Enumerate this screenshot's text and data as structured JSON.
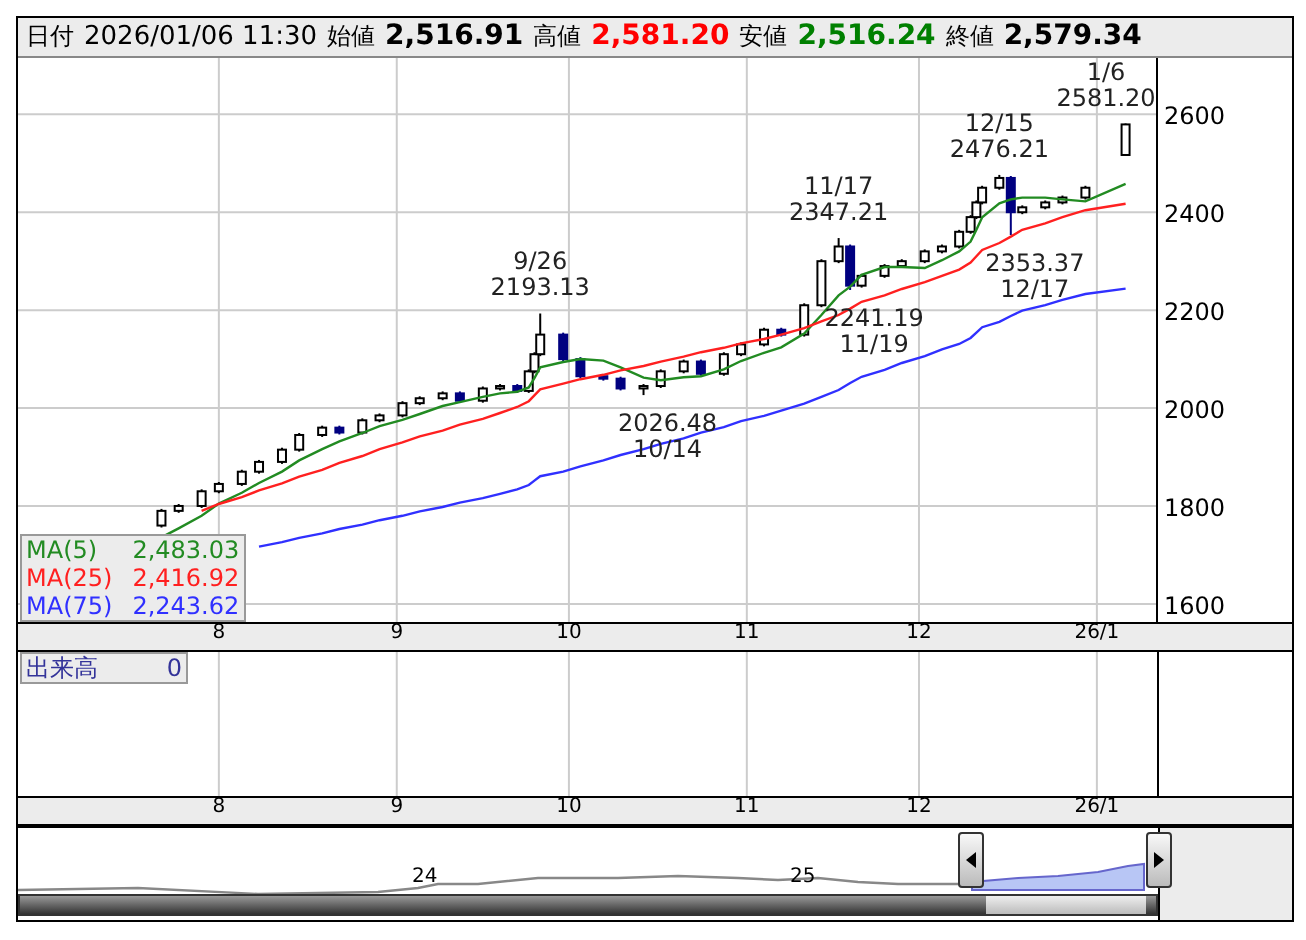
{
  "header": {
    "date_label": "日付",
    "date": "2026/01/06 11:30",
    "quotes": [
      {
        "label": "始値",
        "value": "2,516.91",
        "color": "#000000"
      },
      {
        "label": "高値",
        "value": "2,581.20",
        "color": "#ff0000"
      },
      {
        "label": "安値",
        "value": "2,516.24",
        "color": "#008000"
      },
      {
        "label": "終値",
        "value": "2,579.34",
        "color": "#000000"
      }
    ]
  },
  "price_chart": {
    "chart_data": {
      "type": "candlestick",
      "grid": true,
      "legend": true,
      "x": [
        "2025-07-22",
        "2025-07-25",
        "2025-07-29",
        "2025-08-01",
        "2025-08-05",
        "2025-08-08",
        "2025-08-12",
        "2025-08-15",
        "2025-08-19",
        "2025-08-22",
        "2025-08-26",
        "2025-08-29",
        "2025-09-02",
        "2025-09-05",
        "2025-09-09",
        "2025-09-12",
        "2025-09-16",
        "2025-09-19",
        "2025-09-22",
        "2025-09-24",
        "2025-09-25",
        "2025-09-26",
        "2025-09-30",
        "2025-10-03",
        "2025-10-07",
        "2025-10-10",
        "2025-10-14",
        "2025-10-17",
        "2025-10-21",
        "2025-10-24",
        "2025-10-28",
        "2025-10-31",
        "2025-11-04",
        "2025-11-07",
        "2025-11-11",
        "2025-11-14",
        "2025-11-17",
        "2025-11-19",
        "2025-11-21",
        "2025-11-25",
        "2025-11-28",
        "2025-12-02",
        "2025-12-05",
        "2025-12-08",
        "2025-12-10",
        "2025-12-11",
        "2025-12-12",
        "2025-12-15",
        "2025-12-17",
        "2025-12-19",
        "2025-12-23",
        "2025-12-26",
        "2025-12-30",
        "2026-01-06"
      ],
      "xlim": [
        "2025-06-27",
        "2026-02-04"
      ],
      "ylim": [
        1563,
        2715
      ],
      "yticks": [
        {
          "value": 1600,
          "label": "1600"
        },
        {
          "value": 1800,
          "label": "1800"
        },
        {
          "value": 2000,
          "label": "2000"
        },
        {
          "value": 2200,
          "label": "2200"
        },
        {
          "value": 2400,
          "label": "2400"
        },
        {
          "value": 2600,
          "label": "2600"
        }
      ],
      "xticks": [
        {
          "value": "2025-08-01",
          "label": "8"
        },
        {
          "value": "2025-09-01",
          "label": "9"
        },
        {
          "value": "2025-10-01",
          "label": "10"
        },
        {
          "value": "2025-11-01",
          "label": "11"
        },
        {
          "value": "2025-12-01",
          "label": "12"
        },
        {
          "value": "2026-01-01",
          "label": "26/1"
        }
      ],
      "ohlc": [
        [
          1760,
          1794,
          1756,
          1790
        ],
        [
          1790,
          1804,
          1786,
          1800
        ],
        [
          1800,
          1834,
          1796,
          1830
        ],
        [
          1830,
          1849,
          1826,
          1845
        ],
        [
          1845,
          1874,
          1841,
          1870
        ],
        [
          1870,
          1894,
          1866,
          1890
        ],
        [
          1890,
          1919,
          1886,
          1915
        ],
        [
          1915,
          1949,
          1911,
          1945
        ],
        [
          1945,
          1964,
          1941,
          1960
        ],
        [
          1960,
          1964,
          1946,
          1950
        ],
        [
          1950,
          1979,
          1946,
          1975
        ],
        [
          1975,
          1989,
          1971,
          1985
        ],
        [
          1985,
          2014,
          1981,
          2010
        ],
        [
          2010,
          2024,
          2006,
          2020
        ],
        [
          2020,
          2034,
          2016,
          2030
        ],
        [
          2030,
          2034,
          2011,
          2015
        ],
        [
          2015,
          2044,
          2011,
          2040
        ],
        [
          2040,
          2049,
          2036,
          2045
        ],
        [
          2045,
          2049,
          2031,
          2035
        ],
        [
          2035,
          2079,
          2031,
          2075
        ],
        [
          2075,
          2114,
          2071,
          2110
        ],
        [
          2110,
          2193.13,
          2106,
          2150
        ],
        [
          2150,
          2154,
          2096,
          2100
        ],
        [
          2100,
          2104,
          2061,
          2065
        ],
        [
          2065,
          2069,
          2056,
          2060
        ],
        [
          2060,
          2064,
          2036,
          2040
        ],
        [
          2040,
          2049,
          2026.48,
          2045
        ],
        [
          2045,
          2079,
          2041,
          2075
        ],
        [
          2075,
          2099,
          2071,
          2095
        ],
        [
          2095,
          2099,
          2066,
          2070
        ],
        [
          2070,
          2114,
          2066,
          2110
        ],
        [
          2110,
          2134,
          2106,
          2130
        ],
        [
          2130,
          2164,
          2126,
          2160
        ],
        [
          2160,
          2164,
          2146,
          2150
        ],
        [
          2150,
          2214,
          2146,
          2210
        ],
        [
          2210,
          2304,
          2206,
          2300
        ],
        [
          2300,
          2347.21,
          2296,
          2330
        ],
        [
          2330,
          2334,
          2241.19,
          2250
        ],
        [
          2250,
          2274,
          2246,
          2270
        ],
        [
          2270,
          2294,
          2266,
          2290
        ],
        [
          2290,
          2304,
          2286,
          2300
        ],
        [
          2300,
          2324,
          2296,
          2320
        ],
        [
          2320,
          2334,
          2316,
          2330
        ],
        [
          2330,
          2364,
          2326,
          2360
        ],
        [
          2360,
          2394,
          2356,
          2390
        ],
        [
          2390,
          2424,
          2386,
          2420
        ],
        [
          2420,
          2454,
          2416,
          2450
        ],
        [
          2450,
          2476.21,
          2446,
          2470
        ],
        [
          2470,
          2474,
          2353.37,
          2400
        ],
        [
          2400,
          2414,
          2396,
          2410
        ],
        [
          2410,
          2424,
          2406,
          2420
        ],
        [
          2420,
          2434,
          2416,
          2430
        ],
        [
          2430,
          2454,
          2426,
          2450
        ],
        [
          2516.91,
          2581.2,
          2516.24,
          2579.34
        ]
      ],
      "series": [
        {
          "name": "MA(5)",
          "type": "line",
          "color": "#228b22",
          "values": [
            1736,
            1754,
            1780,
            1805,
            1827,
            1847,
            1870,
            1893,
            1916,
            1932,
            1949,
            1963,
            1976,
            1988,
            2004,
            2012,
            2023,
            2030,
            2033,
            2042,
            2061,
            2083,
            2094,
            2100,
            2097,
            2083,
            2062,
            2057,
            2063,
            2065,
            2079,
            2096,
            2113,
            2124,
            2152,
            2190,
            2230,
            2248,
            2272,
            2288,
            2288,
            2286,
            2302,
            2320,
            2340,
            2364,
            2390,
            2418,
            2426,
            2430,
            2430,
            2426,
            2422,
            2458
          ]
        },
        {
          "name": "MA(25)",
          "type": "line",
          "color": "#ff2020",
          "values": [
            null,
            null,
            1790,
            1804,
            1818,
            1832,
            1846,
            1860,
            1874,
            1888,
            1902,
            1916,
            1930,
            1942,
            1954,
            1966,
            1978,
            1990,
            2002,
            2014,
            2026,
            2038,
            2050,
            2059,
            2068,
            2077,
            2086,
            2095,
            2105,
            2114,
            2123,
            2132,
            2141,
            2150,
            2163,
            2177,
            2190,
            2203,
            2217,
            2230,
            2243,
            2257,
            2270,
            2283,
            2297,
            2310,
            2323,
            2337,
            2350,
            2364,
            2377,
            2390,
            2404,
            2417
          ]
        },
        {
          "name": "MA(75)",
          "type": "line",
          "color": "#3030ff",
          "values": [
            null,
            null,
            null,
            null,
            null,
            1717,
            1726,
            1735,
            1744,
            1753,
            1762,
            1771,
            1780,
            1789,
            1798,
            1807,
            1816,
            1825,
            1834,
            1843,
            1852,
            1861,
            1870,
            1881,
            1893,
            1904,
            1916,
            1927,
            1938,
            1950,
            1961,
            1973,
            1984,
            1995,
            2009,
            2023,
            2037,
            2051,
            2064,
            2078,
            2092,
            2106,
            2120,
            2131,
            2143,
            2154,
            2165,
            2176,
            2188,
            2199,
            2210,
            2221,
            2233,
            2244
          ]
        }
      ],
      "annotations": [
        {
          "x": "2025-09-26",
          "y": 2193.13,
          "text": "9/26\n2193.13"
        },
        {
          "x": "2025-10-14",
          "y": 2026.48,
          "text": "2026.48\n10/14"
        },
        {
          "x": "2025-11-17",
          "y": 2347.21,
          "text": "11/17\n2347.21"
        },
        {
          "x": "2025-11-19",
          "y": 2241.19,
          "text": "2241.19\n11/19"
        },
        {
          "x": "2025-12-15",
          "y": 2476.21,
          "text": "12/15\n2476.21"
        },
        {
          "x": "2025-12-17",
          "y": 2353.37,
          "text": "2353.37\n12/17"
        },
        {
          "x": "2026-01-06",
          "y": 2581.2,
          "text": "1/6\n2581.20"
        }
      ]
    },
    "ma_readings": [
      "2,483.03",
      "2,416.92",
      "2,243.62"
    ]
  },
  "volume": {
    "label": "出来高",
    "value": "0"
  },
  "navigator": {
    "year_labels": [
      "24",
      "25"
    ]
  }
}
